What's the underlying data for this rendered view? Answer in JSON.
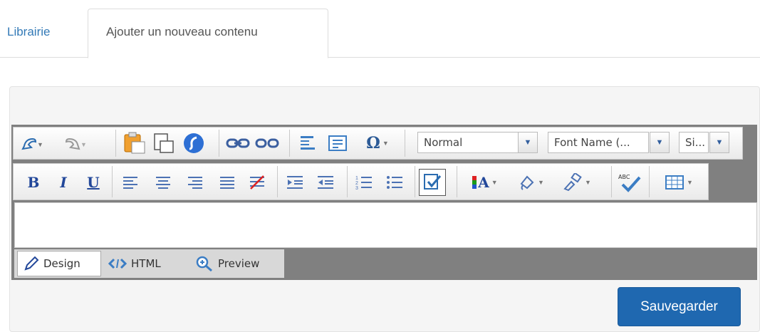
{
  "tabs": {
    "library": "Librairie",
    "add_new": "Ajouter un nouveau contenu"
  },
  "toolbar": {
    "paragraph_format": "Normal",
    "font_name": "Font Name (...",
    "font_size": "Si...",
    "bold": "B",
    "italic": "I",
    "underline": "U",
    "font_color_letter": "A",
    "spellcheck_label": "ABC",
    "icons": [
      "undo-icon",
      "redo-icon",
      "paste-icon",
      "paste-text-icon",
      "flash-icon",
      "link-icon",
      "unlink-icon",
      "paragraph-icon",
      "template-icon",
      "special-char-icon",
      "bold-icon",
      "italic-icon",
      "underline-icon",
      "align-left-icon",
      "align-center-icon",
      "align-right-icon",
      "justify-icon",
      "strikethrough-icon",
      "indent-icon",
      "outdent-icon",
      "ordered-list-icon",
      "unordered-list-icon",
      "form-check-icon",
      "font-color-icon",
      "highlight-icon",
      "format-painter-icon",
      "spellcheck-icon",
      "table-icon"
    ]
  },
  "modes": {
    "design": "Design",
    "html": "HTML",
    "preview": "Preview"
  },
  "actions": {
    "save": "Sauvegarder"
  },
  "colors": {
    "link": "#337ab7",
    "primary_button": "#1f68b0",
    "editor_frame": "#808080"
  }
}
